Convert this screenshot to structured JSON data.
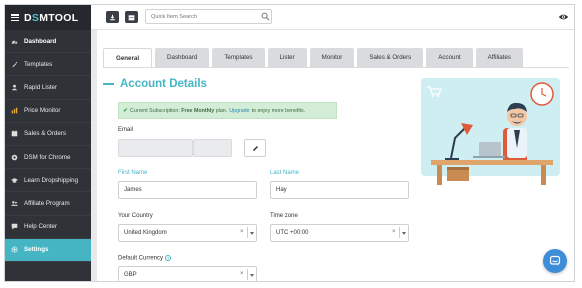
{
  "brand": {
    "prefix": "D",
    "accent": "S",
    "suffix": "MTOOL"
  },
  "sidebar": {
    "items": [
      {
        "label": "Dashboard",
        "icon": "dashboard-icon"
      },
      {
        "label": "Templates",
        "icon": "templates-icon"
      },
      {
        "label": "Rapid Lister",
        "icon": "rapid-lister-icon"
      },
      {
        "label": "Price Monitor",
        "icon": "price-monitor-icon"
      },
      {
        "label": "Sales & Orders",
        "icon": "sales-orders-icon"
      },
      {
        "label": "DSM for Chrome",
        "icon": "chrome-icon"
      },
      {
        "label": "Learn Dropshipping",
        "icon": "graduation-cap-icon"
      },
      {
        "label": "Affiliate Program",
        "icon": "affiliate-icon"
      },
      {
        "label": "Help Center",
        "icon": "help-center-icon"
      },
      {
        "label": "Settings",
        "icon": "gear-icon"
      }
    ]
  },
  "topbar": {
    "search_placeholder": "Quick Item Search"
  },
  "tabs": [
    "General",
    "Dashboard",
    "Templates",
    "Lister",
    "Monitor",
    "Sales & Orders",
    "Account",
    "Affiliates"
  ],
  "main": {
    "title": "Account Details",
    "alert": {
      "prefix": "Current Subscription:",
      "plan": "Free Monthly",
      "middle": "plan.",
      "link": "Upgrade",
      "suffix": "to enjoy more benefits."
    },
    "email": {
      "label": "Email",
      "value": ""
    },
    "first_name": {
      "label": "First Name",
      "value": "James"
    },
    "last_name": {
      "label": "Last Name",
      "value": "Hay"
    },
    "country": {
      "label": "Your Country",
      "value": "United Kingdom"
    },
    "timezone": {
      "label": "Time zone",
      "value": "UTC +00:00"
    },
    "currency": {
      "label": "Default Currency",
      "value": "GBP"
    },
    "clear_symbol": "×"
  },
  "colors": {
    "accent": "#45b5c4",
    "sidebar_bg": "#2f3338",
    "chat": "#3f8cd8"
  }
}
